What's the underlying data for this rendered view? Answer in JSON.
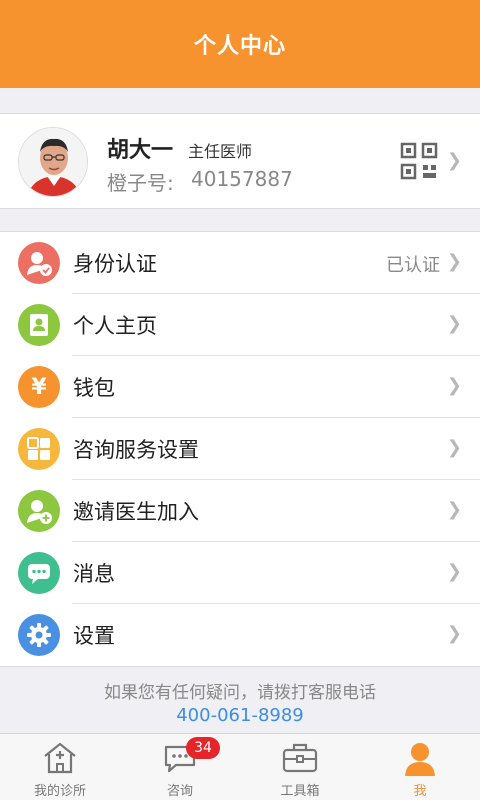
{
  "header": {
    "title": "个人中心"
  },
  "profile": {
    "name": "胡大一",
    "title": "主任医师",
    "id_label": "橙子号:",
    "id_value": "40157887"
  },
  "menu": {
    "items": [
      {
        "label": "身份认证",
        "value": "已认证",
        "icon": "id-verify-icon",
        "color": "#ec6f63"
      },
      {
        "label": "个人主页",
        "value": "",
        "icon": "profile-card-icon",
        "color": "#8dc63f"
      },
      {
        "label": "钱包",
        "value": "",
        "icon": "yen-icon",
        "color": "#f7932e"
      },
      {
        "label": "咨询服务设置",
        "value": "",
        "icon": "grid-settings-icon",
        "color": "#f5b83d"
      },
      {
        "label": "邀请医生加入",
        "value": "",
        "icon": "invite-doctor-icon",
        "color": "#8dc63f"
      },
      {
        "label": "消息",
        "value": "",
        "icon": "message-icon",
        "color": "#3fbf8f"
      },
      {
        "label": "设置",
        "value": "",
        "icon": "gear-icon",
        "color": "#4a90e2"
      }
    ]
  },
  "support": {
    "text": "如果您有任何疑问，请拨打客服电话",
    "phone": "400-061-8989"
  },
  "tabbar": {
    "tabs": [
      {
        "label": "我的诊所",
        "icon": "clinic-icon"
      },
      {
        "label": "咨询",
        "icon": "chat-bubble-icon",
        "badge": "34"
      },
      {
        "label": "工具箱",
        "icon": "toolbox-icon"
      },
      {
        "label": "我",
        "icon": "person-icon",
        "active": true
      }
    ]
  },
  "colors": {
    "accent": "#f7932e",
    "link": "#3a8ee6",
    "badge": "#e6252a"
  }
}
